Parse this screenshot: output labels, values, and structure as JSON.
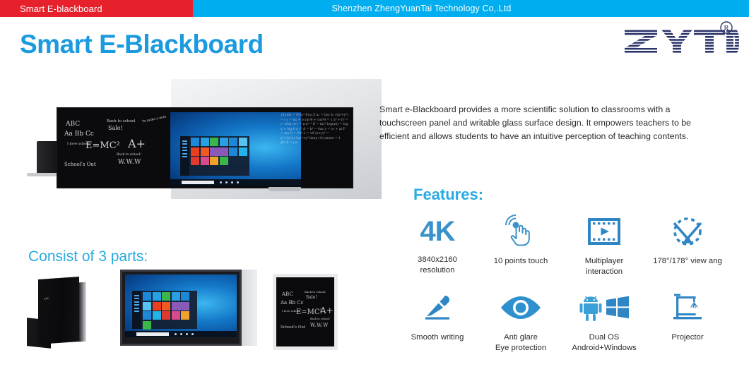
{
  "topbar": {
    "left_label": "Smart E-blackboard",
    "company": "Shenzhen ZhengYuanTai Technology Co,.Ltd",
    "red": "#e7212b",
    "blue": "#00adee"
  },
  "brand": {
    "logo_text": "ZYTD",
    "trademark": "®",
    "logo_color": "#2b3468"
  },
  "page_title": "Smart E-Blackboard",
  "title_color": "#1b9ae0",
  "description": "Smart e-Blackboard provides a more scientific solution to classrooms with a touchscreen panel and writable glass surface design. It empowers teachers to be efficient and allows students to have an intuitive perception of teaching contents.",
  "hero": {
    "chalk": {
      "abc": "ABC",
      "alphabet": "Aa Bb Cc",
      "love_school": "I love\nschool",
      "emc2": "E=MC²",
      "aplus": "A+",
      "back_to_school_small": "Back to school",
      "sale": "Sale!",
      "schools_out": "School's Out",
      "www": "W.W.W",
      "back_to_school_2": "Back to school!",
      "corner_note": "To make a note"
    },
    "equations": "∫f(x)dx = F(b)−F(a)   Σ aₙ = lim Sₙ\n√(x²+y²) = r    y = kx + b\nsin²θ + cos²θ = 1   a² + b² = c²\nd/dx (xⁿ) = n·xⁿ⁻¹   E = mc²\nlog(ab) = log a + log b   π r²\nΔ = b² − 4ac    v = v₀ + at\nF = ma    P = W/t    λ = v/f\n(x+y)³ = x³+3x²y+3xy²+y³\nlim(x→0) sinx/x = 1   ∮B·dl = μ₀I"
  },
  "features": {
    "heading": "Features:",
    "accent": "#29abe2",
    "icon_color": "#3b92c9",
    "items": [
      {
        "icon": "4k-text-icon",
        "big_text": "4K",
        "label": "3840x2160\nresolution"
      },
      {
        "icon": "touch-hand-icon",
        "label": "10 points touch"
      },
      {
        "icon": "film-play-icon",
        "label": "Multiplayer\ninteraction"
      },
      {
        "icon": "view-angle-icon",
        "label": "178°/178° view ang"
      },
      {
        "icon": "pen-writing-icon",
        "label": "Smooth writing"
      },
      {
        "icon": "eye-icon",
        "label": "Anti glare\nEye protection"
      },
      {
        "icon": "android-windows-icon",
        "label": "Dual OS\nAndroid+Windows"
      },
      {
        "icon": "projector-icon",
        "label": "Projector"
      }
    ]
  },
  "parts": {
    "heading": "Consist of 3 parts:",
    "thumbnails": [
      {
        "name": "blackboard-panel-angled"
      },
      {
        "name": "windows-touchscreen-display"
      },
      {
        "name": "blackboard-portrait"
      }
    ]
  }
}
